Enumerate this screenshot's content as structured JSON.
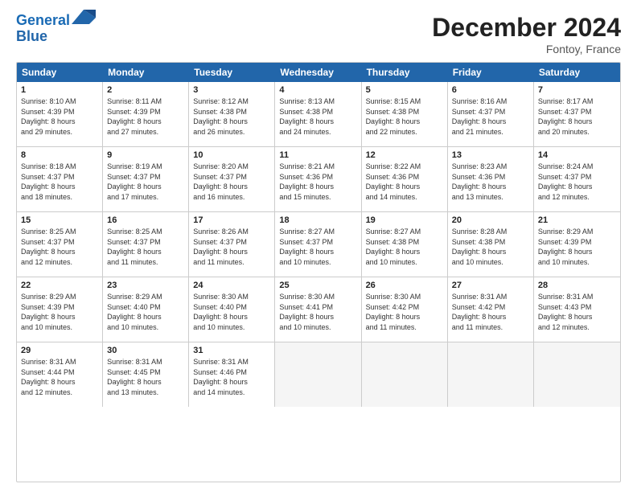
{
  "logo": {
    "line1": "General",
    "line2": "Blue"
  },
  "title": "December 2024",
  "location": "Fontoy, France",
  "header_days": [
    "Sunday",
    "Monday",
    "Tuesday",
    "Wednesday",
    "Thursday",
    "Friday",
    "Saturday"
  ],
  "weeks": [
    [
      {
        "day": "1",
        "text": "Sunrise: 8:10 AM\nSunset: 4:39 PM\nDaylight: 8 hours\nand 29 minutes."
      },
      {
        "day": "2",
        "text": "Sunrise: 8:11 AM\nSunset: 4:39 PM\nDaylight: 8 hours\nand 27 minutes."
      },
      {
        "day": "3",
        "text": "Sunrise: 8:12 AM\nSunset: 4:38 PM\nDaylight: 8 hours\nand 26 minutes."
      },
      {
        "day": "4",
        "text": "Sunrise: 8:13 AM\nSunset: 4:38 PM\nDaylight: 8 hours\nand 24 minutes."
      },
      {
        "day": "5",
        "text": "Sunrise: 8:15 AM\nSunset: 4:38 PM\nDaylight: 8 hours\nand 22 minutes."
      },
      {
        "day": "6",
        "text": "Sunrise: 8:16 AM\nSunset: 4:37 PM\nDaylight: 8 hours\nand 21 minutes."
      },
      {
        "day": "7",
        "text": "Sunrise: 8:17 AM\nSunset: 4:37 PM\nDaylight: 8 hours\nand 20 minutes."
      }
    ],
    [
      {
        "day": "8",
        "text": "Sunrise: 8:18 AM\nSunset: 4:37 PM\nDaylight: 8 hours\nand 18 minutes."
      },
      {
        "day": "9",
        "text": "Sunrise: 8:19 AM\nSunset: 4:37 PM\nDaylight: 8 hours\nand 17 minutes."
      },
      {
        "day": "10",
        "text": "Sunrise: 8:20 AM\nSunset: 4:37 PM\nDaylight: 8 hours\nand 16 minutes."
      },
      {
        "day": "11",
        "text": "Sunrise: 8:21 AM\nSunset: 4:36 PM\nDaylight: 8 hours\nand 15 minutes."
      },
      {
        "day": "12",
        "text": "Sunrise: 8:22 AM\nSunset: 4:36 PM\nDaylight: 8 hours\nand 14 minutes."
      },
      {
        "day": "13",
        "text": "Sunrise: 8:23 AM\nSunset: 4:36 PM\nDaylight: 8 hours\nand 13 minutes."
      },
      {
        "day": "14",
        "text": "Sunrise: 8:24 AM\nSunset: 4:37 PM\nDaylight: 8 hours\nand 12 minutes."
      }
    ],
    [
      {
        "day": "15",
        "text": "Sunrise: 8:25 AM\nSunset: 4:37 PM\nDaylight: 8 hours\nand 12 minutes."
      },
      {
        "day": "16",
        "text": "Sunrise: 8:25 AM\nSunset: 4:37 PM\nDaylight: 8 hours\nand 11 minutes."
      },
      {
        "day": "17",
        "text": "Sunrise: 8:26 AM\nSunset: 4:37 PM\nDaylight: 8 hours\nand 11 minutes."
      },
      {
        "day": "18",
        "text": "Sunrise: 8:27 AM\nSunset: 4:37 PM\nDaylight: 8 hours\nand 10 minutes."
      },
      {
        "day": "19",
        "text": "Sunrise: 8:27 AM\nSunset: 4:38 PM\nDaylight: 8 hours\nand 10 minutes."
      },
      {
        "day": "20",
        "text": "Sunrise: 8:28 AM\nSunset: 4:38 PM\nDaylight: 8 hours\nand 10 minutes."
      },
      {
        "day": "21",
        "text": "Sunrise: 8:29 AM\nSunset: 4:39 PM\nDaylight: 8 hours\nand 10 minutes."
      }
    ],
    [
      {
        "day": "22",
        "text": "Sunrise: 8:29 AM\nSunset: 4:39 PM\nDaylight: 8 hours\nand 10 minutes."
      },
      {
        "day": "23",
        "text": "Sunrise: 8:29 AM\nSunset: 4:40 PM\nDaylight: 8 hours\nand 10 minutes."
      },
      {
        "day": "24",
        "text": "Sunrise: 8:30 AM\nSunset: 4:40 PM\nDaylight: 8 hours\nand 10 minutes."
      },
      {
        "day": "25",
        "text": "Sunrise: 8:30 AM\nSunset: 4:41 PM\nDaylight: 8 hours\nand 10 minutes."
      },
      {
        "day": "26",
        "text": "Sunrise: 8:30 AM\nSunset: 4:42 PM\nDaylight: 8 hours\nand 11 minutes."
      },
      {
        "day": "27",
        "text": "Sunrise: 8:31 AM\nSunset: 4:42 PM\nDaylight: 8 hours\nand 11 minutes."
      },
      {
        "day": "28",
        "text": "Sunrise: 8:31 AM\nSunset: 4:43 PM\nDaylight: 8 hours\nand 12 minutes."
      }
    ],
    [
      {
        "day": "29",
        "text": "Sunrise: 8:31 AM\nSunset: 4:44 PM\nDaylight: 8 hours\nand 12 minutes."
      },
      {
        "day": "30",
        "text": "Sunrise: 8:31 AM\nSunset: 4:45 PM\nDaylight: 8 hours\nand 13 minutes."
      },
      {
        "day": "31",
        "text": "Sunrise: 8:31 AM\nSunset: 4:46 PM\nDaylight: 8 hours\nand 14 minutes."
      },
      {
        "day": "",
        "text": ""
      },
      {
        "day": "",
        "text": ""
      },
      {
        "day": "",
        "text": ""
      },
      {
        "day": "",
        "text": ""
      }
    ]
  ]
}
